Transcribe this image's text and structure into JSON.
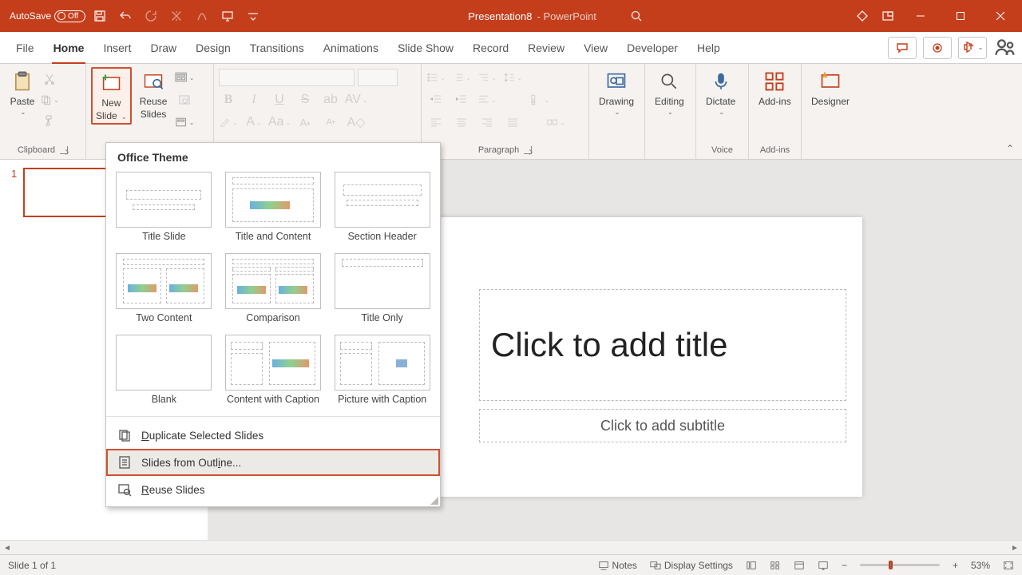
{
  "titlebar": {
    "autosave_label": "AutoSave",
    "autosave_state": "Off",
    "doc_name": "Presentation8",
    "app_suffix": " -  PowerPoint"
  },
  "tabs": {
    "file": "File",
    "items": [
      "Home",
      "Insert",
      "Draw",
      "Design",
      "Transitions",
      "Animations",
      "Slide Show",
      "Record",
      "Review",
      "View",
      "Developer",
      "Help"
    ],
    "active_index": 0
  },
  "ribbon": {
    "clipboard": {
      "paste": "Paste",
      "label": "Clipboard"
    },
    "slides": {
      "new_slide_line1": "New",
      "new_slide_line2": "Slide",
      "reuse_line1": "Reuse",
      "reuse_line2": "Slides"
    },
    "paragraph_label": "Paragraph",
    "drawing": "Drawing",
    "editing": "Editing",
    "dictate": "Dictate",
    "voice_label": "Voice",
    "addins": "Add-ins",
    "addins_label": "Add-ins",
    "designer": "Designer"
  },
  "dropdown": {
    "header": "Office Theme",
    "layouts": [
      "Title Slide",
      "Title and Content",
      "Section Header",
      "Two Content",
      "Comparison",
      "Title Only",
      "Blank",
      "Content with Caption",
      "Picture with Caption"
    ],
    "dup_prefix": "D",
    "dup_rest": "uplicate Selected Slides",
    "outline_text": "Slides from Outl",
    "outline_u": "i",
    "outline_suffix": "ne...",
    "reuse_prefix": "R",
    "reuse_rest": "euse Slides"
  },
  "canvas": {
    "thumb_num": "1",
    "title_placeholder": "Click to add title",
    "subtitle_placeholder": "Click to add subtitle"
  },
  "status": {
    "slide_info": "Slide 1 of 1",
    "notes": "Notes",
    "display": "Display Settings",
    "zoom": "53%"
  }
}
